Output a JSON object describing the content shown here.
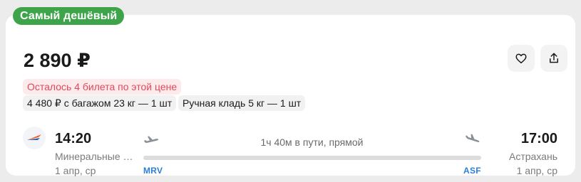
{
  "badge": "Самый дешёвый",
  "price": "2 890 ₽",
  "actions": {
    "favorite_icon": "heart-icon",
    "share_icon": "share-icon"
  },
  "tickets_left": "Осталось 4 билета по этой цене",
  "options": [
    "4 480 ₽ с багажом 23 кг — 1 шт",
    "Ручная кладь 5 кг — 1 шт"
  ],
  "flight": {
    "departure": {
      "time": "14:20",
      "city": "Минеральные …",
      "date": "1 апр, ср",
      "iata": "MRV"
    },
    "arrival": {
      "time": "17:00",
      "city": "Астрахань",
      "date": "1 апр, ср",
      "iata": "ASF"
    },
    "duration": "1ч 40м в пути, прямой"
  },
  "colors": {
    "badge_bg": "#3da44a",
    "warn_text": "#e0485e",
    "warn_bg": "#fdeaea",
    "iata": "#2d7fd6"
  }
}
